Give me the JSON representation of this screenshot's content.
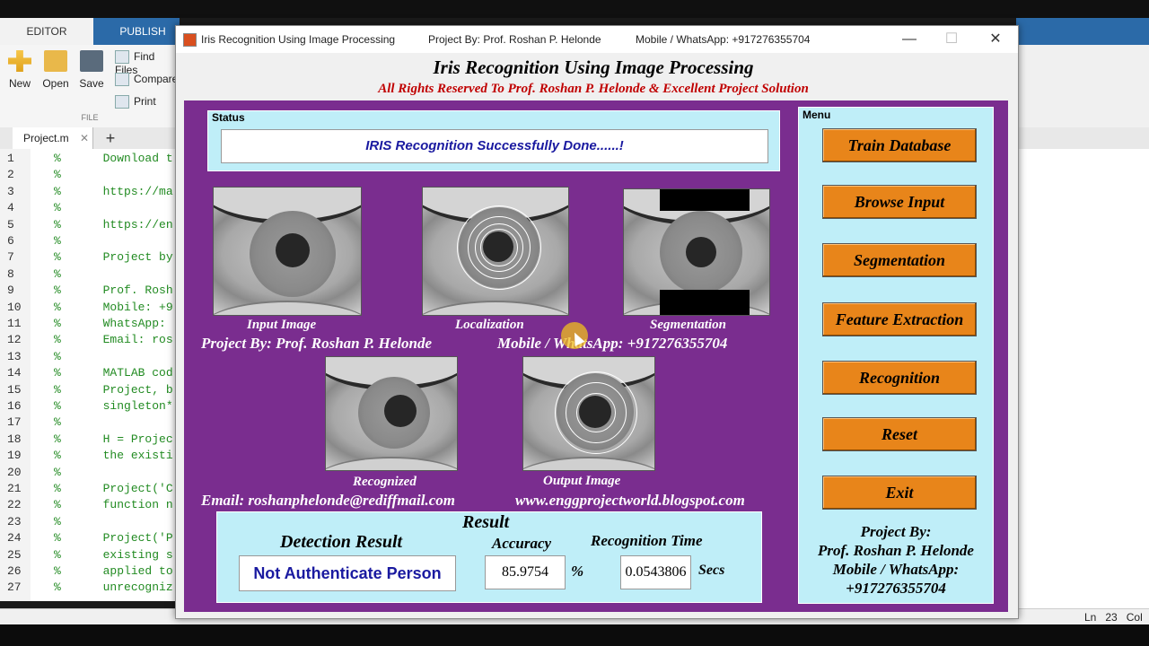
{
  "matlab": {
    "tabs": [
      "EDITOR",
      "PUBLISH"
    ],
    "ribbon": {
      "new": "New",
      "open": "Open",
      "save": "Save",
      "find_files": "Find Files",
      "compare": "Compare",
      "print": "Print",
      "section": "FILE"
    },
    "file_tab": "Project.m",
    "code_lines": [
      {
        "n": "1",
        "t": "%      Download t"
      },
      {
        "n": "2",
        "t": "%"
      },
      {
        "n": "3",
        "t": "%      https://ma"
      },
      {
        "n": "4",
        "t": "%"
      },
      {
        "n": "5",
        "t": "%      https://en"
      },
      {
        "n": "6",
        "t": "%"
      },
      {
        "n": "7",
        "t": "%      Project by"
      },
      {
        "n": "8",
        "t": "%"
      },
      {
        "n": "9",
        "t": "%      Prof. Rosh"
      },
      {
        "n": "10",
        "t": "%      Mobile: +9"
      },
      {
        "n": "11",
        "t": "%      WhatsApp:"
      },
      {
        "n": "12",
        "t": "%      Email: ros"
      },
      {
        "n": "13",
        "t": "%"
      },
      {
        "n": "14",
        "t": "%      MATLAB cod"
      },
      {
        "n": "15",
        "t": "%      Project, b"
      },
      {
        "n": "16",
        "t": "%      singleton*"
      },
      {
        "n": "17",
        "t": "%"
      },
      {
        "n": "18",
        "t": "%      H = Projec"
      },
      {
        "n": "19",
        "t": "%      the existi"
      },
      {
        "n": "20",
        "t": "%"
      },
      {
        "n": "21",
        "t": "%      Project('C"
      },
      {
        "n": "22",
        "t": "%      function n"
      },
      {
        "n": "23",
        "t": "%"
      },
      {
        "n": "24",
        "t": "%      Project('P"
      },
      {
        "n": "25",
        "t": "%      existing s"
      },
      {
        "n": "26",
        "t": "%      applied to"
      },
      {
        "n": "27",
        "t": "%      unrecogniz"
      }
    ],
    "status": {
      "ln_label": "Ln",
      "ln_value": "23",
      "col_label": "Col"
    }
  },
  "figure": {
    "titlebar": {
      "title": "Iris Recognition Using Image Processing",
      "project_by": "Project By: Prof. Roshan P. Helonde",
      "mobile": "Mobile / WhatsApp: +917276355704",
      "minimize": "—",
      "maximize": "☐",
      "close": "✕"
    },
    "header_title": "Iris Recognition Using Image Processing",
    "header_subtitle": "All Rights Reserved To Prof. Roshan P. Helonde & Excellent Project Solution",
    "status": {
      "label": "Status",
      "message": "IRIS Recognition Successfully Done......!"
    },
    "images": {
      "input": "Input Image",
      "localization": "Localization",
      "segmentation": "Segmentation",
      "recognized": "Recognized",
      "output": "Output Image"
    },
    "credits": {
      "project_by": "Project By: Prof. Roshan P. Helonde",
      "mobile": "Mobile / WhatsApp: +917276355704",
      "email": "Email: roshanphelonde@rediffmail.com",
      "website": "www.enggprojectworld.blogspot.com"
    },
    "result": {
      "title": "Result",
      "detection_label": "Detection Result",
      "detection_value": "Not Authenticate Person",
      "accuracy_label": "Accuracy",
      "accuracy_value": "85.9754",
      "accuracy_unit": "%",
      "time_label": "Recognition Time",
      "time_value": "0.0543806",
      "time_unit": "Secs"
    },
    "menu": {
      "label": "Menu",
      "buttons": [
        "Train Database",
        "Browse Input",
        "Segmentation",
        "Feature Extraction",
        "Recognition",
        "Reset",
        "Exit"
      ],
      "credit_lines": [
        "Project By:",
        "Prof. Roshan P. Helonde",
        "Mobile / WhatsApp:",
        "+917276355704"
      ]
    },
    "colors": {
      "panel": "#7a2d8f",
      "subpanel": "#bfeef8",
      "button": "#e8851a",
      "subtitle": "#c00000",
      "status_text": "#1a1aa0"
    }
  }
}
